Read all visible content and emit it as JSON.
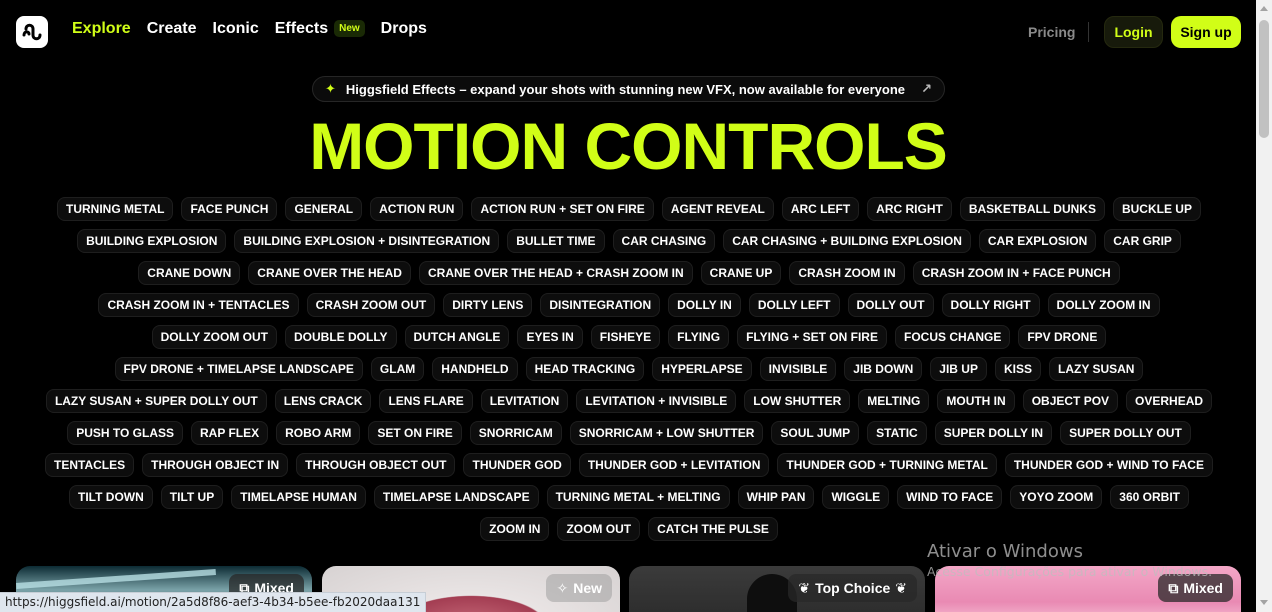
{
  "nav": {
    "logo_icon": "higgsfield-logo-icon",
    "links": [
      {
        "label": "Explore",
        "active": true
      },
      {
        "label": "Create"
      },
      {
        "label": "Iconic"
      },
      {
        "label": "Effects",
        "badge": "New"
      },
      {
        "label": "Drops"
      }
    ],
    "pricing": "Pricing",
    "login": "Login",
    "signup": "Sign up"
  },
  "announcement": {
    "icon": "sparkle-icon",
    "text": "Higgsfield Effects – expand your shots with stunning new VFX, now available for everyone",
    "arrow_icon": "arrow-up-right-icon"
  },
  "title": "MOTION CONTROLS",
  "tags": [
    "TURNING METAL",
    "FACE PUNCH",
    "GENERAL",
    "ACTION RUN",
    "ACTION RUN + SET ON FIRE",
    "AGENT REVEAL",
    "ARC LEFT",
    "ARC RIGHT",
    "BASKETBALL DUNKS",
    "BUCKLE UP",
    "BUILDING EXPLOSION",
    "BUILDING EXPLOSION + DISINTEGRATION",
    "BULLET TIME",
    "CAR CHASING",
    "CAR CHASING + BUILDING EXPLOSION",
    "CAR EXPLOSION",
    "CAR GRIP",
    "CRANE DOWN",
    "CRANE OVER THE HEAD",
    "CRANE OVER THE HEAD + CRASH ZOOM IN",
    "CRANE UP",
    "CRASH ZOOM IN",
    "CRASH ZOOM IN + FACE PUNCH",
    "CRASH ZOOM IN + TENTACLES",
    "CRASH ZOOM OUT",
    "DIRTY LENS",
    "DISINTEGRATION",
    "DOLLY IN",
    "DOLLY LEFT",
    "DOLLY OUT",
    "DOLLY RIGHT",
    "DOLLY ZOOM IN",
    "DOLLY ZOOM OUT",
    "DOUBLE DOLLY",
    "DUTCH ANGLE",
    "EYES IN",
    "FISHEYE",
    "FLYING",
    "FLYING + SET ON FIRE",
    "FOCUS CHANGE",
    "FPV DRONE",
    "FPV DRONE + TIMELAPSE LANDSCAPE",
    "GLAM",
    "HANDHELD",
    "HEAD TRACKING",
    "HYPERLAPSE",
    "INVISIBLE",
    "JIB DOWN",
    "JIB UP",
    "KISS",
    "LAZY SUSAN",
    "LAZY SUSAN + SUPER DOLLY OUT",
    "LENS CRACK",
    "LENS FLARE",
    "LEVITATION",
    "LEVITATION + INVISIBLE",
    "LOW SHUTTER",
    "MELTING",
    "MOUTH IN",
    "OBJECT POV",
    "OVERHEAD",
    "PUSH TO GLASS",
    "RAP FLEX",
    "ROBO ARM",
    "SET ON FIRE",
    "SNORRICAM",
    "SNORRICAM + LOW SHUTTER",
    "SOUL JUMP",
    "STATIC",
    "SUPER DOLLY IN",
    "SUPER DOLLY OUT",
    "TENTACLES",
    "THROUGH OBJECT IN",
    "THROUGH OBJECT OUT",
    "THUNDER GOD",
    "THUNDER GOD + LEVITATION",
    "THUNDER GOD + TURNING METAL",
    "THUNDER GOD + WIND TO FACE",
    "TILT DOWN",
    "TILT UP",
    "TIMELAPSE HUMAN",
    "TIMELAPSE LANDSCAPE",
    "TURNING METAL + MELTING",
    "WHIP PAN",
    "WIGGLE",
    "WIND TO FACE",
    "YOYO ZOOM",
    "360 ORBIT",
    "ZOOM IN",
    "ZOOM OUT",
    "CATCH THE PULSE"
  ],
  "cards": [
    {
      "badge": "Mixed",
      "icon": "copy-icon"
    },
    {
      "badge": "New",
      "icon": "sparkle-icon"
    },
    {
      "badge": "Top Choice",
      "icon": "laurel-icon"
    },
    {
      "badge": "Mixed",
      "icon": "copy-icon"
    }
  ],
  "watermark": {
    "title": "Ativar o Windows",
    "subtitle": "Acesse Configurações para ativar o Windows."
  },
  "status_url": "https://higgsfield.ai/motion/2a5d8f86-aef3-4b34-b5ee-fb2020daa131",
  "colors": {
    "accent": "#d1fe17",
    "background": "#000000"
  }
}
